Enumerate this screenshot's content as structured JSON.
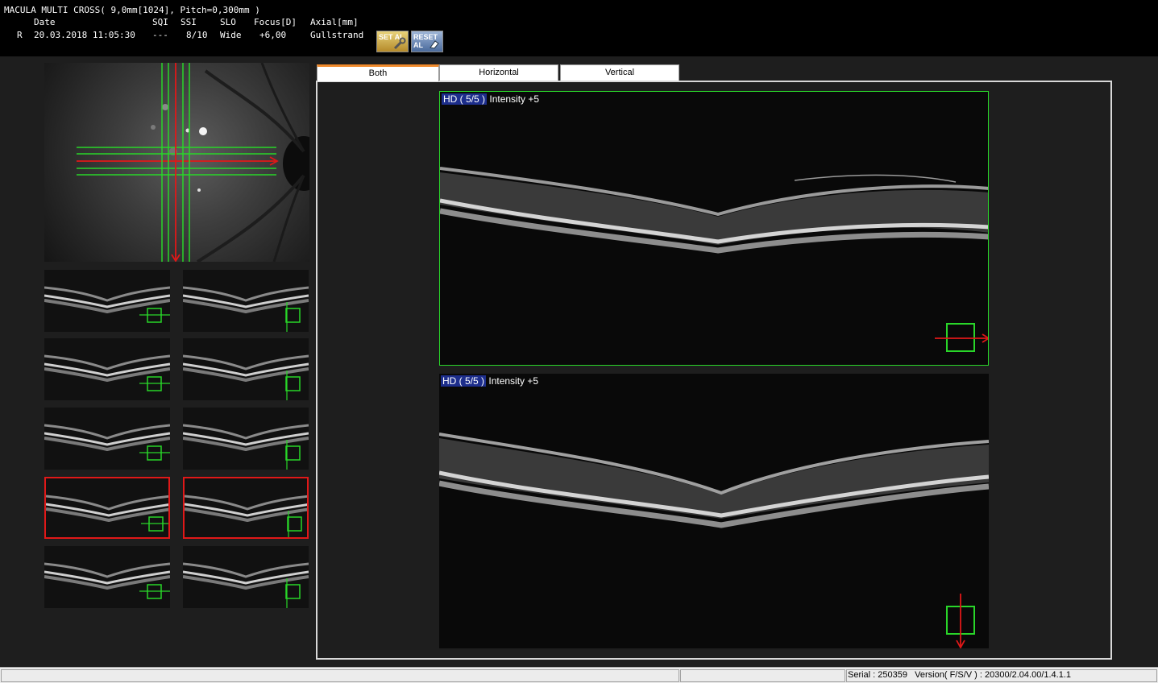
{
  "header": {
    "protocol": "MACULA MULTI CROSS( 9,0mm[1024], Pitch=0,300mm )",
    "col_heads": [
      "Date",
      "SQI",
      "SSI",
      "SLO",
      "Focus[D]",
      "Axial[mm]"
    ],
    "eye": "R",
    "date": "20.03.2018 11:05:30",
    "sqi": "---",
    "ssi": "8/10",
    "slo": "Wide",
    "focus": "+6,00",
    "axial": "Gullstrand",
    "set_button": "SET AL",
    "reset_button": "RESET AL"
  },
  "tabs": [
    {
      "label": "Both",
      "active": true
    },
    {
      "label": "Horizontal",
      "active": false
    },
    {
      "label": "Vertical",
      "active": false
    }
  ],
  "scans": [
    {
      "badge": "HD ( 5/5 )",
      "intensity": "Intensity +5",
      "orientation": "horizontal"
    },
    {
      "badge": "HD ( 5/5 )",
      "intensity": "Intensity +5",
      "orientation": "vertical"
    }
  ],
  "thumbnails": {
    "rows": 5,
    "selected_row": 3
  },
  "statusbar": {
    "serial": "Serial : 250359",
    "version": "Version( F/S/V ) : 20300/2.04.00/1.4.1.1"
  },
  "colors": {
    "scan_line": "#29d629",
    "selected": "#e01818",
    "active_tab": "#f08a2c"
  }
}
